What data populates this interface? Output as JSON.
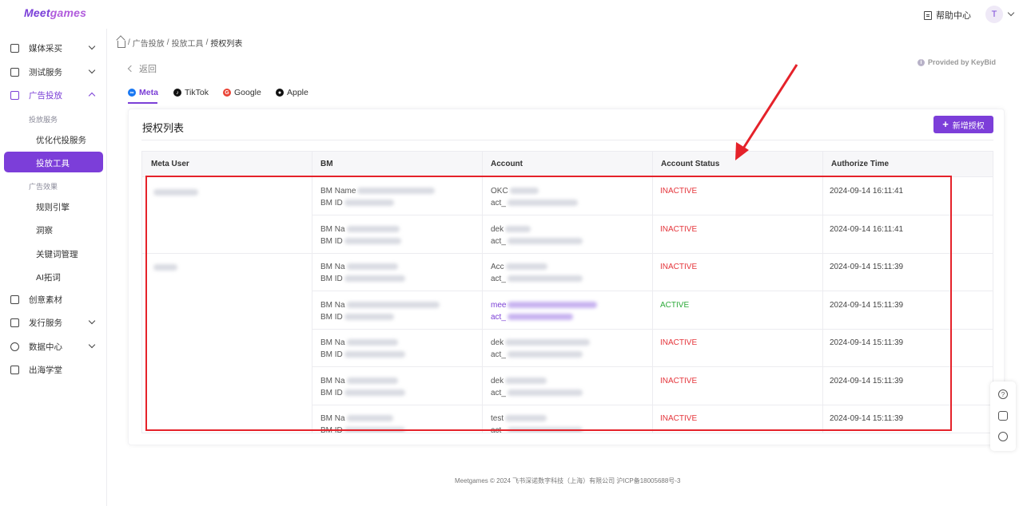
{
  "brand": {
    "logo_part1": "Meet",
    "logo_part2": "games",
    "accent": "#7c3ed9"
  },
  "header": {
    "help_label": "帮助中心",
    "avatar_letter": "T"
  },
  "sidebar": {
    "items": [
      {
        "label": "媒体采买",
        "icon": "media-icon"
      },
      {
        "label": "测试服务",
        "icon": "test-icon"
      },
      {
        "label": "广告投放",
        "icon": "ads-icon"
      },
      {
        "label": "创意素材",
        "icon": "creative-icon"
      },
      {
        "label": "发行服务",
        "icon": "publish-icon"
      },
      {
        "label": "数据中心",
        "icon": "data-icon"
      },
      {
        "label": "出海学堂",
        "icon": "academy-icon"
      }
    ],
    "group_ad_service": "投放服务",
    "sub_optimize": "优化代投服务",
    "sub_tool": "投放工具",
    "group_ad_effect": "广告效果",
    "sub_rules": "规则引擎",
    "sub_insight": "洞察",
    "sub_keywords": "关键词管理",
    "sub_ai": "AI拓词"
  },
  "breadcrumb": {
    "part1": "广告投放",
    "part2": "投放工具",
    "current": "授权列表",
    "sep": "/"
  },
  "back_label": "返回",
  "provided_by": "Provided by KeyBid",
  "tabs": [
    "Meta",
    "TikTok",
    "Google",
    "Apple"
  ],
  "card": {
    "title": "授权列表",
    "add_button": "新增授权",
    "columns": [
      "Meta User",
      "BM",
      "Account",
      "Account Status",
      "Authorize Time"
    ],
    "rows": [
      {
        "bm_name": "BM Name",
        "bm_id": "BM ID",
        "acc1": "OKC",
        "acc2": "act_",
        "status": "INACTIVE",
        "time": "2024-09-14 16:11:41"
      },
      {
        "bm_name": "BM Na",
        "bm_id": "BM ID",
        "acc1": "dek",
        "acc2": "act_",
        "status": "INACTIVE",
        "time": "2024-09-14 16:11:41"
      },
      {
        "bm_name": "BM Na",
        "bm_id": "BM ID",
        "acc1": "Acc",
        "acc2": "act_",
        "status": "INACTIVE",
        "time": "2024-09-14 15:11:39"
      },
      {
        "bm_name": "BM Na",
        "bm_id": "BM ID",
        "acc1": "mee",
        "acc2": "act_",
        "status": "ACTIVE",
        "time": "2024-09-14 15:11:39"
      },
      {
        "bm_name": "BM Na",
        "bm_id": "BM ID",
        "acc1": "dek",
        "acc2": "act_",
        "status": "INACTIVE",
        "time": "2024-09-14 15:11:39"
      },
      {
        "bm_name": "BM Na",
        "bm_id": "BM ID",
        "acc1": "dek",
        "acc2": "act_",
        "status": "INACTIVE",
        "time": "2024-09-14 15:11:39"
      },
      {
        "bm_name": "BM Na",
        "bm_id": "BM ID",
        "acc1": "test",
        "acc2": "act_",
        "status": "INACTIVE",
        "time": "2024-09-14 15:11:39"
      }
    ]
  },
  "status_colors": {
    "INACTIVE": "#e5353b",
    "ACTIVE": "#2daa3a"
  },
  "footer": "Meetgames © 2024 飞书深诺数字科技（上海）有限公司 沪ICP备18005688号-3"
}
